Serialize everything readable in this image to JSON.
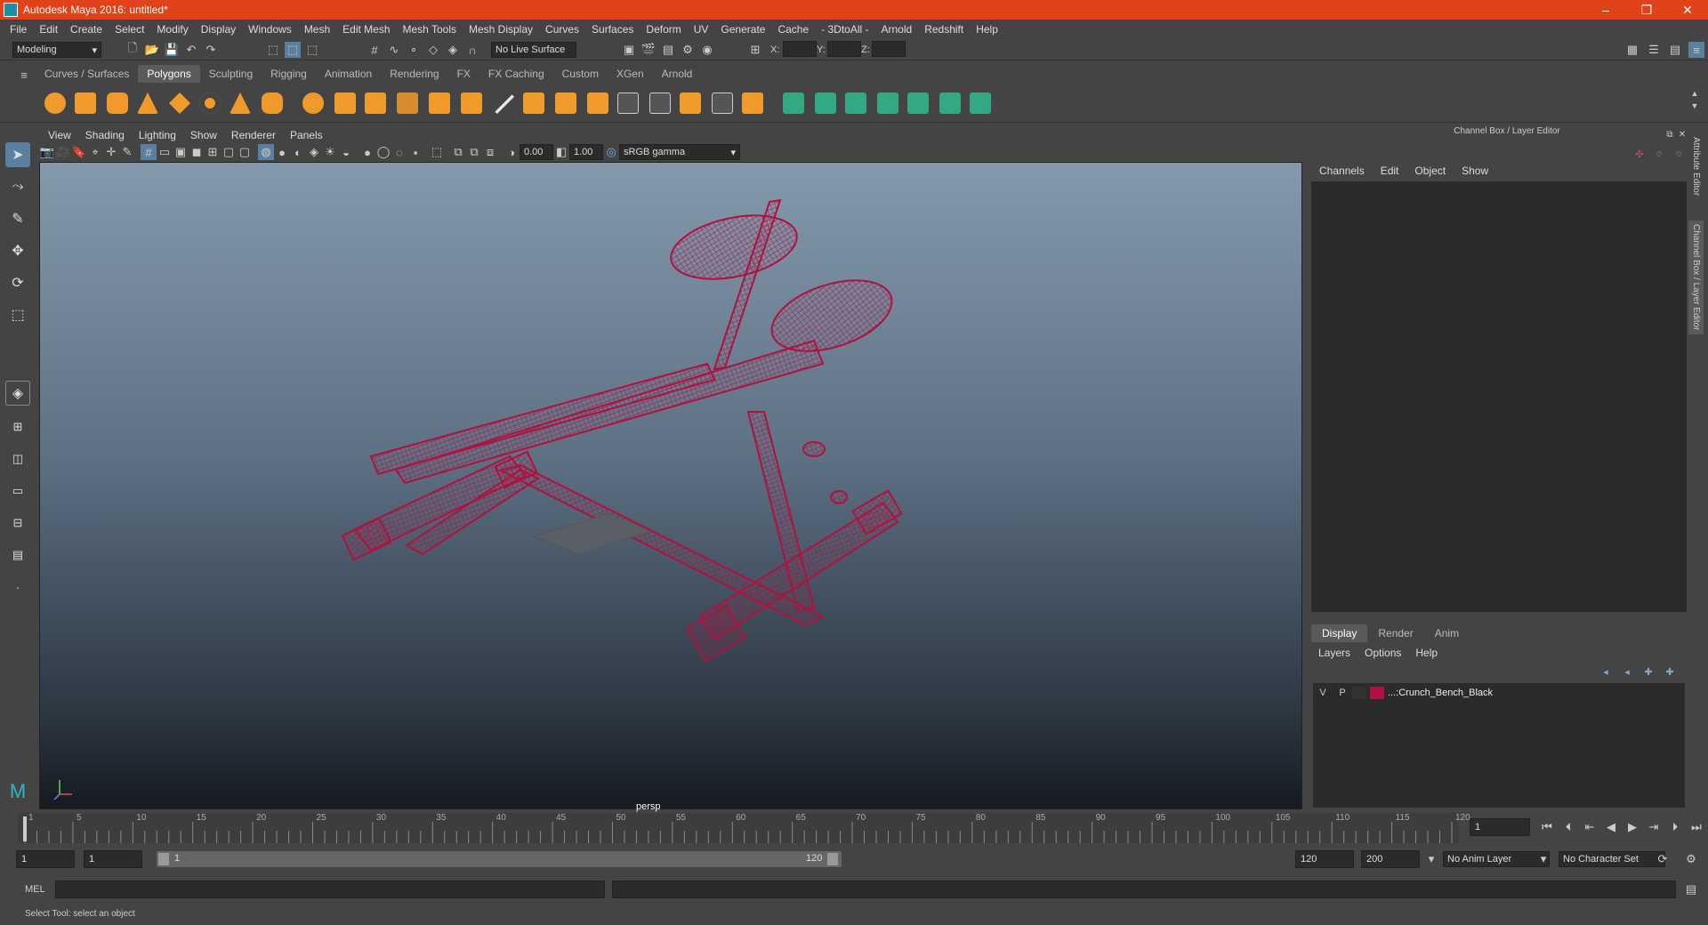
{
  "app": {
    "title": "Autodesk Maya 2016: untitled*",
    "window_controls": [
      "–",
      "❐",
      "✕"
    ]
  },
  "menubar": [
    "File",
    "Edit",
    "Create",
    "Select",
    "Modify",
    "Display",
    "Windows",
    "Mesh",
    "Edit Mesh",
    "Mesh Tools",
    "Mesh Display",
    "Curves",
    "Surfaces",
    "Deform",
    "UV",
    "Generate",
    "Cache",
    "- 3DtoAll -",
    "Arnold",
    "Redshift",
    "Help"
  ],
  "statusline": {
    "menuset": "Modeling",
    "live_surface": "No Live Surface",
    "x_label": "X:",
    "y_label": "Y:",
    "z_label": "Z:"
  },
  "shelf": {
    "tabs": [
      "Curves / Surfaces",
      "Polygons",
      "Sculpting",
      "Rigging",
      "Animation",
      "Rendering",
      "FX",
      "FX Caching",
      "Custom",
      "XGen",
      "Arnold"
    ],
    "active_tab": "Polygons",
    "poly_color": "#f19a2c",
    "edit_color": "#33a885"
  },
  "viewport": {
    "menus": [
      "View",
      "Shading",
      "Lighting",
      "Show",
      "Renderer",
      "Panels"
    ],
    "exposure": "0.00",
    "gamma": "1.00",
    "color_space": "sRGB gamma",
    "camera_label": "persp",
    "wire_color": "#b0123f"
  },
  "channel_box": {
    "header": "Channel Box / Layer Editor",
    "menus": [
      "Channels",
      "Edit",
      "Object",
      "Show"
    ]
  },
  "layer_editor": {
    "tabs": [
      "Display",
      "Render",
      "Anim"
    ],
    "active_tab": "Display",
    "menus": [
      "Layers",
      "Options",
      "Help"
    ],
    "layers": [
      {
        "v": "V",
        "p": "P",
        "color": "#b0123f",
        "name": "...:Crunch_Bench_Black"
      }
    ]
  },
  "side_tabs": [
    "Attribute Editor",
    "Channel Box / Layer Editor"
  ],
  "timeline": {
    "ticks": [
      "1",
      "5",
      "10",
      "15",
      "20",
      "25",
      "30",
      "35",
      "40",
      "45",
      "50",
      "55",
      "60",
      "65",
      "70",
      "75",
      "80",
      "85",
      "90",
      "95",
      "100",
      "105",
      "110",
      "115",
      "120"
    ],
    "current_frame": "1"
  },
  "range": {
    "start": "1",
    "playback_start": "1",
    "slider_start": "1",
    "slider_end": "120",
    "playback_end": "120",
    "end": "200",
    "anim_layer": "No Anim Layer",
    "char_set": "No Character Set"
  },
  "command_line": {
    "label": "MEL"
  },
  "help_line": "Select Tool: select an object"
}
